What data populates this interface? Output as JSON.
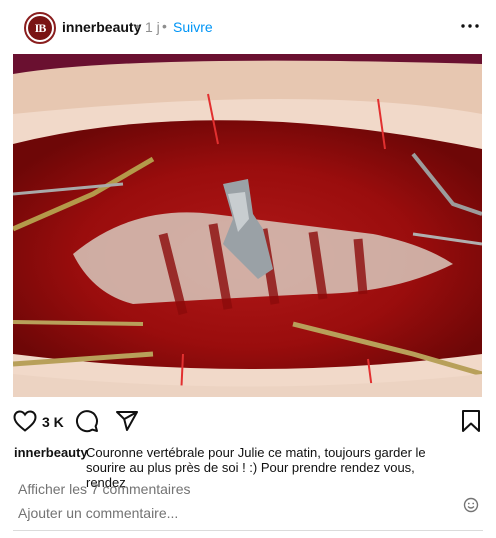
{
  "post": {
    "username": "innerbeauty",
    "avatar_text": "IB",
    "separator": "•",
    "time": "1 j",
    "follow_label": "Suivre",
    "likes": "3 K",
    "caption_user": "innerbeauty",
    "caption_text": "Couronne vertébrale pour Julie ce matin, toujours garder le sourire au plus près de soi ! :) Pour prendre rendez vous, rendez",
    "view_comments": "Afficher les 7 commentaires",
    "add_comment_placeholder": "Ajouter un commentaire..."
  },
  "icons": {
    "more": "more-options-icon",
    "like": "heart-icon",
    "comment": "comment-icon",
    "share": "send-icon",
    "save": "bookmark-icon",
    "emoji": "emoji-icon"
  },
  "colors": {
    "link_blue": "#0095f6",
    "muted": "#737373",
    "avatar": "#7a1414"
  }
}
